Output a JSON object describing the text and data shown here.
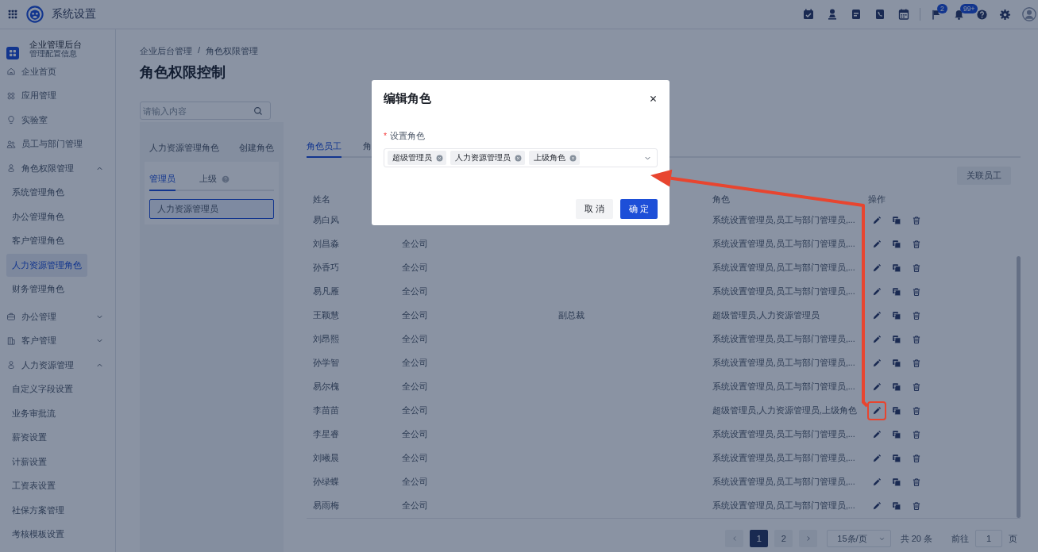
{
  "header": {
    "title": "系统设置",
    "flag_badge": "2",
    "bell_badge": "99+"
  },
  "sidebar": {
    "org": {
      "name": "企业管理后台",
      "subtitle": "管理配置信息"
    },
    "items": [
      {
        "label": "企业首页"
      },
      {
        "label": "应用管理"
      },
      {
        "label": "实验室"
      },
      {
        "label": "员工与部门管理"
      },
      {
        "label": "角色权限管理",
        "expanded": true,
        "children": [
          {
            "label": "系统管理角色",
            "selected": false
          },
          {
            "label": "办公管理角色",
            "selected": false
          },
          {
            "label": "客户管理角色",
            "selected": false
          },
          {
            "label": "人力资源管理角色",
            "selected": true
          },
          {
            "label": "财务管理角色",
            "selected": false
          }
        ]
      },
      {
        "label": "办公管理",
        "expanded": false
      },
      {
        "label": "客户管理",
        "expanded": false
      },
      {
        "label": "人力资源管理",
        "expanded": true,
        "children": [
          {
            "label": "自定义字段设置",
            "selected": false
          },
          {
            "label": "业务审批流",
            "selected": false
          },
          {
            "label": "薪资设置",
            "selected": false
          },
          {
            "label": "计薪设置",
            "selected": false
          },
          {
            "label": "工资表设置",
            "selected": false
          },
          {
            "label": "社保方案管理",
            "selected": false
          },
          {
            "label": "考核模板设置",
            "selected": false
          }
        ]
      }
    ]
  },
  "breadcrumb": [
    "企业后台管理",
    "角色权限管理"
  ],
  "separator": "/",
  "title": "角色权限控制",
  "search": {
    "placeholder": "请输入内容"
  },
  "role_panel": {
    "group_title": "人力资源管理角色",
    "create_link": "创建角色",
    "tabs": [
      {
        "label": "管理员",
        "selected": true,
        "help": false
      },
      {
        "label": "上级",
        "selected": false,
        "help": true
      }
    ],
    "roles": [
      {
        "label": "人力资源管理员",
        "selected": true
      }
    ]
  },
  "tabs": [
    {
      "label": "角色员工",
      "selected": true
    },
    {
      "label": "角",
      "selected": false
    }
  ],
  "link_button": "关联员工",
  "table": {
    "columns": {
      "name": "姓名",
      "role": "角色",
      "actions": "操作"
    },
    "rows": [
      {
        "name": "易白风",
        "role": "系统设置管理员,员工与部门管理员,...",
        "highlighted": false
      },
      {
        "name": "刘昌淼",
        "column_2": "全公司",
        "role": "系统设置管理员,员工与部门管理员,...",
        "highlighted": false
      },
      {
        "name": "孙香巧",
        "column_2": "全公司",
        "role": "系统设置管理员,员工与部门管理员,...",
        "highlighted": false
      },
      {
        "name": "易凡雁",
        "column_2": "全公司",
        "role": "系统设置管理员,员工与部门管理员,...",
        "highlighted": false
      },
      {
        "name": "王颖慧",
        "column_2": "全公司",
        "column_3": "副总裁",
        "role": "超级管理员,人力资源管理员",
        "highlighted": false
      },
      {
        "name": "刘昂熙",
        "column_2": "全公司",
        "role": "系统设置管理员,员工与部门管理员,...",
        "highlighted": false
      },
      {
        "name": "孙学智",
        "column_2": "全公司",
        "role": "系统设置管理员,员工与部门管理员,...",
        "highlighted": false
      },
      {
        "name": "易尔槐",
        "column_2": "全公司",
        "role": "系统设置管理员,员工与部门管理员,...",
        "highlighted": false
      },
      {
        "name": "李苗苗",
        "column_2": "全公司",
        "role": "超级管理员,人力资源管理员,上级角色",
        "highlighted": true
      },
      {
        "name": "李星睿",
        "column_2": "全公司",
        "role": "系统设置管理员,员工与部门管理员,...",
        "highlighted": false
      },
      {
        "name": "刘曦晨",
        "column_2": "全公司",
        "role": "系统设置管理员,员工与部门管理员,...",
        "highlighted": false
      },
      {
        "name": "孙绿蝶",
        "column_2": "全公司",
        "role": "系统设置管理员,员工与部门管理员,...",
        "highlighted": false
      },
      {
        "name": "易雨梅",
        "column_2": "全公司",
        "role": "系统设置管理员,员工与部门管理员,...",
        "highlighted": false
      }
    ]
  },
  "pagination": {
    "pages": [
      {
        "label": "1",
        "selected": true
      },
      {
        "label": "2",
        "selected": false
      }
    ],
    "page_size": "15条/页",
    "total": "共 20 条",
    "goto_label": "前往",
    "goto_value": "1",
    "goto_suffix": "页"
  },
  "dialog": {
    "title": "编辑角色",
    "field_label": "设置角色",
    "required_mark": "*",
    "tags": [
      "超级管理员",
      "人力资源管理员",
      "上级角色"
    ],
    "cancel": "取 消",
    "ok": "确 定"
  },
  "annotation": {
    "arrow": true
  }
}
